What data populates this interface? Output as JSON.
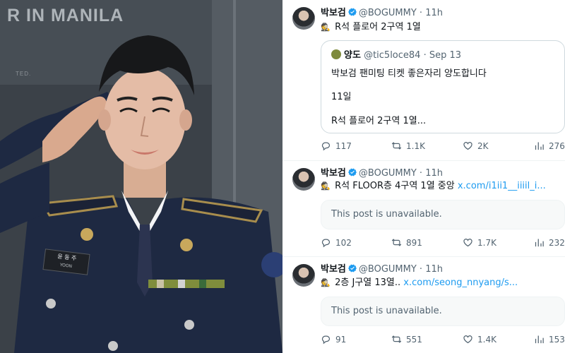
{
  "photo": {
    "banner": "R IN MANILA",
    "banner_small": "TED.",
    "nameplate_name": "윤 동 주",
    "nameplate_sub": "YOON"
  },
  "tweets": [
    {
      "name": "박보검",
      "handle": "@BOGUMMY",
      "dot": "·",
      "time": "11h",
      "emoji": "🕵",
      "text": "R석 플로어 2구역 1열",
      "quote": {
        "name": "양도",
        "handle": "@tic5loce84",
        "dot": "·",
        "time": "Sep 13",
        "lines": [
          "박보검 팬미팅 티켓 좋은자리 양도합니다",
          "11일",
          "R석 플로어 2구역 1열..."
        ]
      },
      "replies": "117",
      "reposts": "1.1K",
      "likes": "2K",
      "views": "276K"
    },
    {
      "name": "박보검",
      "handle": "@BOGUMMY",
      "dot": "·",
      "time": "11h",
      "emoji": "🕵",
      "text": "R석 FLOOR층 4구역 1열 중앙 ",
      "link": "x.com/i1ii1__iiiil_i...",
      "unavailable": "This post is unavailable.",
      "replies": "102",
      "reposts": "891",
      "likes": "1.7K",
      "views": "232K"
    },
    {
      "name": "박보검",
      "handle": "@BOGUMMY",
      "dot": "·",
      "time": "11h",
      "emoji": "🕵",
      "text": "2층 J구열 13열.. ",
      "link": "x.com/seong_nnyang/s...",
      "unavailable": "This post is unavailable.",
      "replies": "91",
      "reposts": "551",
      "likes": "1.4K",
      "views": "153K"
    }
  ],
  "colors": {
    "verified": "#1d9bf0",
    "link": "#1d9bf0",
    "muted": "#536471",
    "uniform": "#1f2a44",
    "wall": "#3d444b"
  },
  "icons": [
    "reply-icon",
    "repost-icon",
    "like-icon",
    "views-icon",
    "verified-badge-icon",
    "spy-emoji-icon"
  ]
}
